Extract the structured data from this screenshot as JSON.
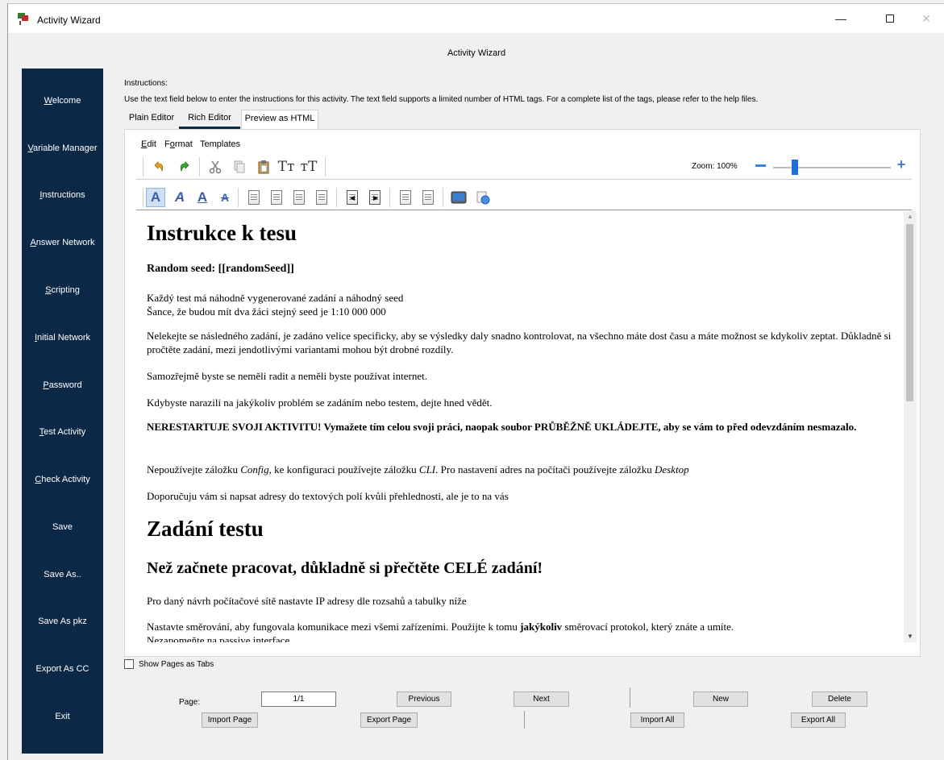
{
  "window": {
    "title": "Activity Wizard"
  },
  "header": {
    "title": "Activity Wizard"
  },
  "sidebar": {
    "items": [
      {
        "label": "Welcome",
        "mnemonic": "W",
        "rest": "elcome"
      },
      {
        "label": "Variable Manager",
        "mnemonic": "V",
        "rest": "ariable Manager"
      },
      {
        "label": "Instructions",
        "mnemonic": "I",
        "rest": "nstructions"
      },
      {
        "label": "Answer Network",
        "mnemonic": "A",
        "rest": "nswer Network"
      },
      {
        "label": "Scripting",
        "mnemonic": "S",
        "rest": "cripting"
      },
      {
        "label": "Initial Network",
        "mnemonic": "I",
        "rest": "nitial Network"
      },
      {
        "label": "Password",
        "mnemonic": "P",
        "rest": "assword"
      },
      {
        "label": "Test Activity",
        "mnemonic": "T",
        "rest": "est Activity"
      },
      {
        "label": "Check Activity",
        "mnemonic": "C",
        "rest": "heck Activity"
      },
      {
        "label": "Save"
      },
      {
        "label": "Save As.."
      },
      {
        "label": "Save As pkz"
      },
      {
        "label": "Export As CC"
      },
      {
        "label": "Exit"
      }
    ]
  },
  "instructions": {
    "heading": "Instructions:",
    "description": "Use the text field below to enter the instructions for this activity. The text field supports a limited number of HTML tags. For a complete list of the tags, please refer to the help files."
  },
  "tabs": [
    {
      "label": "Plain Editor"
    },
    {
      "label": "Rich Editor",
      "active": true
    },
    {
      "label": "Preview as HTML"
    }
  ],
  "editor": {
    "menu": {
      "edit": {
        "mnemonic": "E",
        "rest": "dit"
      },
      "format": {
        "pre": "F",
        "mnemonic": "o",
        "rest": "rmat"
      },
      "templates": {
        "label": "Templates"
      }
    },
    "toolbar1_icons": [
      "undo-icon",
      "redo-icon",
      "cut-icon",
      "copy-icon",
      "paste-icon",
      "font-size-increase-icon",
      "font-size-decrease-icon"
    ],
    "toolbar2_icons": [
      "bold-icon",
      "italic-icon",
      "underline-icon",
      "strikethrough-icon",
      "align-left-icon",
      "align-center-icon",
      "align-right-icon",
      "align-justify-icon",
      "indent-decrease-icon",
      "indent-increase-icon",
      "ordered-list-icon",
      "unordered-list-icon",
      "insert-image-icon",
      "insert-link-icon"
    ],
    "zoom": {
      "label": "Zoom: 100%",
      "value": 100,
      "level": 0.17
    }
  },
  "document": {
    "h1_1": "Instrukce k tesu",
    "seed": "Random seed: [[randomSeed]]",
    "p1_line1": "Každý test má náhodně vygenerované zadání a náhodný seed",
    "p1_line2": "Šance, že budou mít dva žáci stejný seed je 1:10 000 000",
    "p2": "Nelekejte se následného zadání, je zadáno velice specificky, aby se výsledky daly snadno kontrolovat, na všechno máte dost času a máte možnost se kdykoliv zeptat. Důkladně si pročtěte zadání, mezi jendotlivými variantami mohou být drobné rozdíly.",
    "p3": "Samozřejmě byste se neměli radit a neměli byste používat internet.",
    "p4": "Kdybyste narazili na jakýkoliv problém se zadáním nebo testem, dejte hned vědět.",
    "p5": "NERESTARTUJE SVOJI AKTIVITU! Vymažete tím celou svoji práci, naopak soubor PRŮBĚŽNĚ UKLÁDEJTE, aby se vám to před odevzdáním nesmazalo.",
    "p6_a": "Nepoužívejte záložku ",
    "p6_b": "Config",
    "p6_c": ", ke konfiguraci používejte záložku ",
    "p6_d": "CLI",
    "p6_e": ". Pro nastavení adres na počítači používejte záložku ",
    "p6_f": "Desktop",
    "p7": "Doporučuju vám si napsat adresy do textových polí kvůli přehlednosti, ale je to na vás",
    "h1_2": "Zadání testu",
    "h2_1": "Než začnete pracovat, důkladně si přečtěte CELÉ zadání!",
    "p8": "Pro daný návrh počítačové sítě nastavte IP adresy dle rozsahů a tabulky níže",
    "p9_a": "Nastavte směrování, aby fungovala komunikace mezi všemi zařízeními. Použijte k tomu ",
    "p9_b": "jakýkoliv",
    "p9_c": " směrovací protokol, který znáte a umíte.",
    "p9_line2": "Nezapomeňte na passive interface."
  },
  "show_pages_as_tabs": {
    "label": "Show Pages as Tabs",
    "checked": false
  },
  "pager": {
    "page_label": "Page:",
    "page_value": "1/1",
    "previous": "Previous",
    "next": "Next",
    "new": "New",
    "delete": "Delete",
    "import_page": "Import Page",
    "export_page": "Export Page",
    "import_all": "Import All",
    "export_all": "Export All"
  }
}
